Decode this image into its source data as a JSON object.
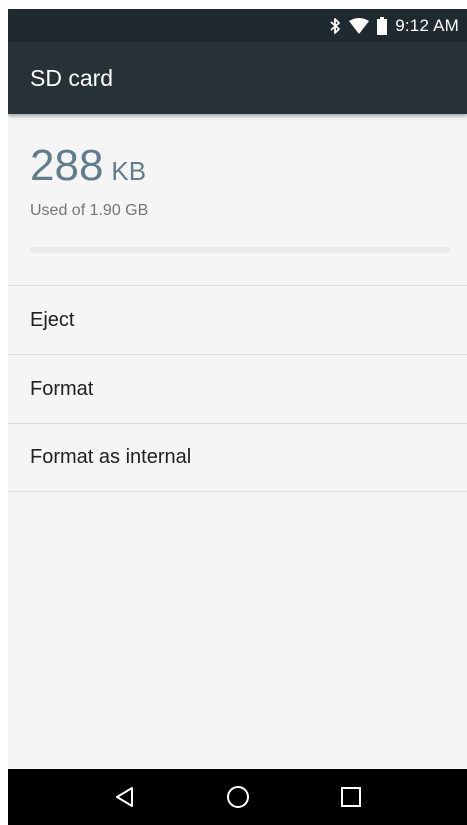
{
  "status_bar": {
    "time": "9:12 AM",
    "icons": [
      "bluetooth-icon",
      "wifi-icon",
      "battery-icon"
    ]
  },
  "app_bar": {
    "title": "SD card"
  },
  "storage": {
    "used_amount": "288",
    "used_unit": "KB",
    "summary": "Used of 1.90 GB",
    "used_fraction": 0.0001
  },
  "menu": {
    "items": [
      {
        "label": "Eject"
      },
      {
        "label": "Format"
      },
      {
        "label": "Format as internal"
      }
    ]
  },
  "nav_bar": {
    "buttons": [
      "back-icon",
      "home-icon",
      "recents-icon"
    ]
  },
  "colors": {
    "status_bar": "#1f2a30",
    "app_bar": "#263238",
    "accent": "#607d8b",
    "background": "#f5f5f5"
  }
}
